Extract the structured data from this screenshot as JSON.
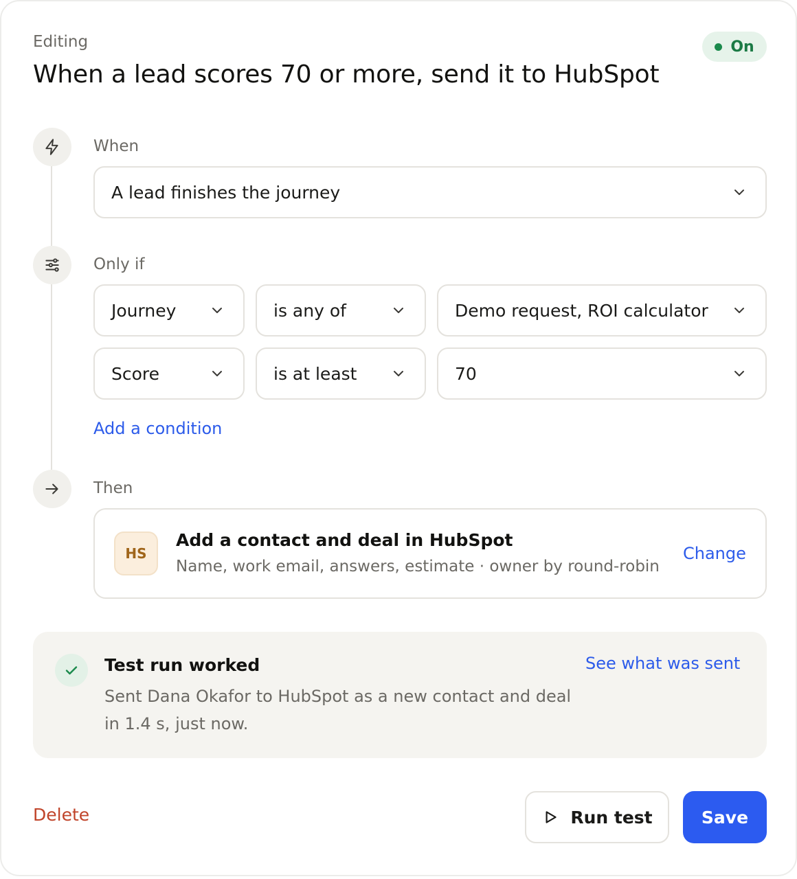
{
  "header": {
    "eyebrow": "Editing",
    "title": "When a lead scores 70 or more, send it to HubSpot",
    "status": "On"
  },
  "when": {
    "label": "When",
    "trigger": "A lead finishes the journey"
  },
  "only_if": {
    "label": "Only if",
    "conditions": [
      {
        "field": "Journey",
        "operator": "is any of",
        "value": "Demo request, ROI calculator"
      },
      {
        "field": "Score",
        "operator": "is at least",
        "value": "70"
      }
    ],
    "add_condition": "Add a condition"
  },
  "then": {
    "label": "Then",
    "badge": "HS",
    "title": "Add a contact and deal in HubSpot",
    "subtitle": "Name, work email, answers, estimate · owner by round-robin",
    "change": "Change"
  },
  "test_result": {
    "title": "Test run worked",
    "body": "Sent Dana Okafor to HubSpot as a new contact and deal in 1.4 s, just now.",
    "link": "See what was sent"
  },
  "footer": {
    "delete": "Delete",
    "run_test": "Run test",
    "save": "Save"
  },
  "colors": {
    "accent": "#2c5bf0",
    "link": "#2c5bea",
    "success": "#1b8a4c",
    "danger": "#c0442a"
  },
  "icons": {
    "when": "lightning-icon",
    "only_if": "filter-sliders-icon",
    "then": "arrow-right-icon",
    "result": "check-icon",
    "run": "play-icon"
  }
}
